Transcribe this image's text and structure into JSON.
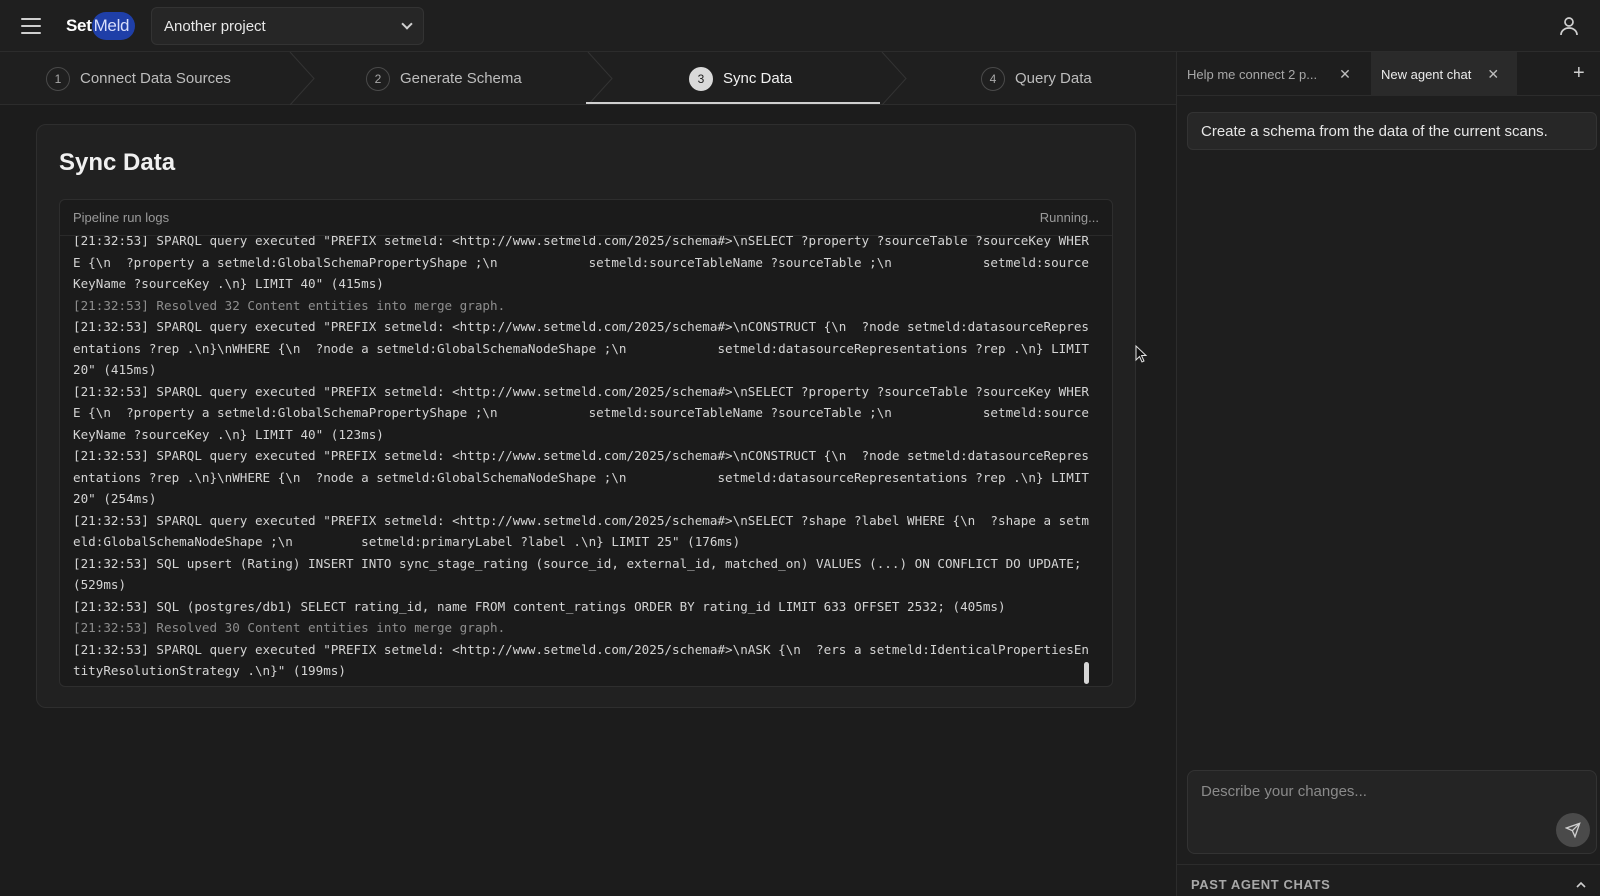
{
  "app": {
    "logo_set": "Set",
    "logo_meld": "Meld",
    "project": "Another project"
  },
  "steps": [
    {
      "num": "1",
      "label": "Connect Data Sources"
    },
    {
      "num": "2",
      "label": "Generate Schema"
    },
    {
      "num": "3",
      "label": "Sync Data",
      "active": true
    },
    {
      "num": "4",
      "label": "Query Data"
    }
  ],
  "main": {
    "title": "Sync Data",
    "log_title": "Pipeline run logs",
    "status": "Running...",
    "logs": [
      {
        "text": "[21:32:53] SPARQL query executed \"PREFIX setmeld: <http://www.setmeld.com/2025/schema#>\\nSELECT ?property ?sourceTable ?sourceKey WHERE {\\n  ?property a setmeld:GlobalSchemaPropertyShape ;\\n            setmeld:sourceTableName ?sourceTable ;\\n            setmeld:sourceKeyName ?sourceKey .\\n} LIMIT 40\" (415ms)",
        "muted": false
      },
      {
        "text": "[21:32:53] Resolved 32 Content entities into merge graph.",
        "muted": true
      },
      {
        "text": "[21:32:53] SPARQL query executed \"PREFIX setmeld: <http://www.setmeld.com/2025/schema#>\\nCONSTRUCT {\\n  ?node setmeld:datasourceRepresentations ?rep .\\n}\\nWHERE {\\n  ?node a setmeld:GlobalSchemaNodeShape ;\\n            setmeld:datasourceRepresentations ?rep .\\n} LIMIT 20\" (415ms)",
        "muted": false
      },
      {
        "text": "[21:32:53] SPARQL query executed \"PREFIX setmeld: <http://www.setmeld.com/2025/schema#>\\nSELECT ?property ?sourceTable ?sourceKey WHERE {\\n  ?property a setmeld:GlobalSchemaPropertyShape ;\\n            setmeld:sourceTableName ?sourceTable ;\\n            setmeld:sourceKeyName ?sourceKey .\\n} LIMIT 40\" (123ms)",
        "muted": false
      },
      {
        "text": "[21:32:53] SPARQL query executed \"PREFIX setmeld: <http://www.setmeld.com/2025/schema#>\\nCONSTRUCT {\\n  ?node setmeld:datasourceRepresentations ?rep .\\n}\\nWHERE {\\n  ?node a setmeld:GlobalSchemaNodeShape ;\\n            setmeld:datasourceRepresentations ?rep .\\n} LIMIT 20\" (254ms)",
        "muted": false
      },
      {
        "text": "[21:32:53] SPARQL query executed \"PREFIX setmeld: <http://www.setmeld.com/2025/schema#>\\nSELECT ?shape ?label WHERE {\\n  ?shape a setmeld:GlobalSchemaNodeShape ;\\n         setmeld:primaryLabel ?label .\\n} LIMIT 25\" (176ms)",
        "muted": false
      },
      {
        "text": "[21:32:53] SQL upsert (Rating) INSERT INTO sync_stage_rating (source_id, external_id, matched_on) VALUES (...) ON CONFLICT DO UPDATE; (529ms)",
        "muted": false
      },
      {
        "text": "[21:32:53] SQL (postgres/db1) SELECT rating_id, name FROM content_ratings ORDER BY rating_id LIMIT 633 OFFSET 2532; (405ms)",
        "muted": false
      },
      {
        "text": "[21:32:53] Resolved 30 Content entities into merge graph.",
        "muted": true
      },
      {
        "text": "[21:32:53] SPARQL query executed \"PREFIX setmeld: <http://www.setmeld.com/2025/schema#>\\nASK {\\n  ?ers a setmeld:IdenticalPropertiesEntityResolutionStrategy .\\n}\" (199ms)",
        "muted": false
      }
    ]
  },
  "chat": {
    "tabs": [
      {
        "label": "Help me connect 2 p...",
        "active": false
      },
      {
        "label": "New agent chat",
        "active": true
      }
    ],
    "message": "Create a schema from the data of the current scans.",
    "composer_placeholder": "Describe your changes...",
    "past_label": "PAST AGENT CHATS"
  },
  "icons": {
    "menu": "hamburger-icon",
    "user": "user-icon",
    "send": "send-icon",
    "close": "close-icon",
    "add": "plus-icon",
    "collapse": "chevron-up-icon"
  }
}
